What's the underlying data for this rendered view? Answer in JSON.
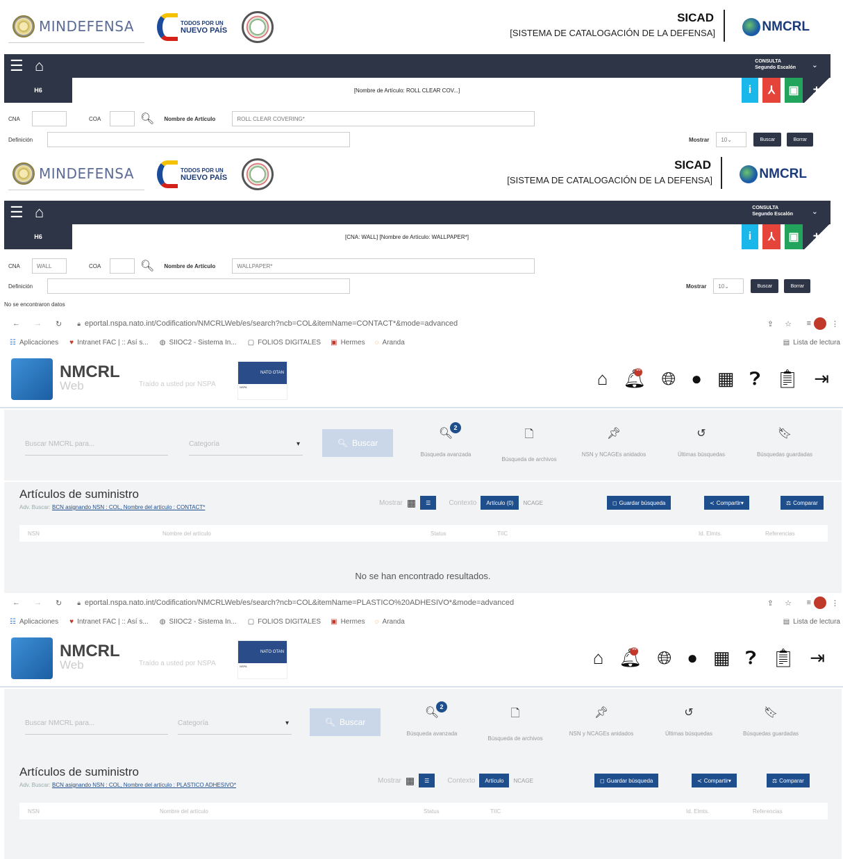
{
  "sicad": {
    "brand": "MINDEFENSA",
    "todos_line1": "TODOS POR UN",
    "todos_line2": "NUEVO PAÍS",
    "title": "SICAD",
    "subtitle": "[SISTEMA DE CATALOGACIÓN DE LA DEFENSA]",
    "nmcrl": "NMCRL",
    "consulta_l1": "CONSULTA",
    "consulta_l2": "Segundo Escalón",
    "h6": "H6",
    "labels": {
      "cna": "CNA",
      "coa": "COA",
      "nombre": "Nombre de Artículo",
      "definicion": "Definición",
      "mostrar": "Mostrar",
      "buscar": "Buscar",
      "borrar": "Borrar"
    },
    "mostrar_value": "10"
  },
  "panel1": {
    "header": "[Nombre de Artículo: ROLL CLEAR COV...]",
    "cna_value": "",
    "nombre_value": "ROLL CLEAR COVERING*"
  },
  "panel2": {
    "header": "[CNA: WALL]  [Nombre de Artículo: WALLPAPER*]",
    "cna_value": "WALL",
    "nombre_value": "WALLPAPER*",
    "no_data": "No se encontraron datos"
  },
  "browser1": {
    "url": "eportal.nspa.nato.int/Codification/NMCRLWeb/es/search?ncb=COL&itemName=CONTACT*&mode=advanced"
  },
  "browser2": {
    "url": "eportal.nspa.nato.int/Codification/NMCRLWeb/es/search?ncb=COL&itemName=PLASTICO%20ADHESIVO*&mode=advanced"
  },
  "bookmarks": [
    {
      "icon": "apps-icon",
      "glyph": "☷",
      "label": "Aplicaciones"
    },
    {
      "icon": "heart-icon",
      "glyph": "♥",
      "label": "Intranet FAC | :: Así s..."
    },
    {
      "icon": "globe-icon",
      "glyph": "◍",
      "label": "SIIOC2 - Sistema In..."
    },
    {
      "icon": "folder-icon",
      "glyph": "▢",
      "label": "FOLIOS DIGITALES"
    },
    {
      "icon": "hermes-icon",
      "glyph": "▣",
      "label": "Hermes"
    },
    {
      "icon": "aranda-icon",
      "glyph": "◌",
      "label": "Aranda"
    }
  ],
  "reading_list": "Lista de lectura",
  "nmcrl": {
    "title": "NMCRL",
    "sub": "Web",
    "tagline": "Traído a usted por NSPA",
    "notif_count": "99",
    "search_placeholder": "Buscar NMCRL para...",
    "category_placeholder": "Categoría",
    "search_button": "Buscar",
    "adv_badge": "2",
    "tools": [
      "Búsqueda avanzada",
      "Búsqueda de archivos",
      "NSN y NCAGEs anidados",
      "Últimas búsquedas",
      "Búsquedas guardadas"
    ],
    "results_title": "Artículos de suministro",
    "mostrar": "Mostrar",
    "contexto": "Contexto",
    "ctx_articulo_1": "Artículo (0)",
    "ctx_articulo_2": "Artículo",
    "ctx_ncage": "NCAGE",
    "guardar": "Guardar búsqueda",
    "compartir": "Compartir",
    "comparar": "Comparar",
    "adv_label": "Adv. Buscar:",
    "adv_query_1": "BCN asignando NSN : COL, Nombre del artículo : CONTACT*",
    "adv_query_2": "BCN asignando NSN : COL, Nombre del artículo : PLASTICO ADHESIVO*",
    "columns": [
      "NSN",
      "Nombre del artículo",
      "Status",
      "TIIC",
      "Id. Elmts.",
      "Referencias"
    ],
    "no_results": "No se han encontrado resultados."
  }
}
